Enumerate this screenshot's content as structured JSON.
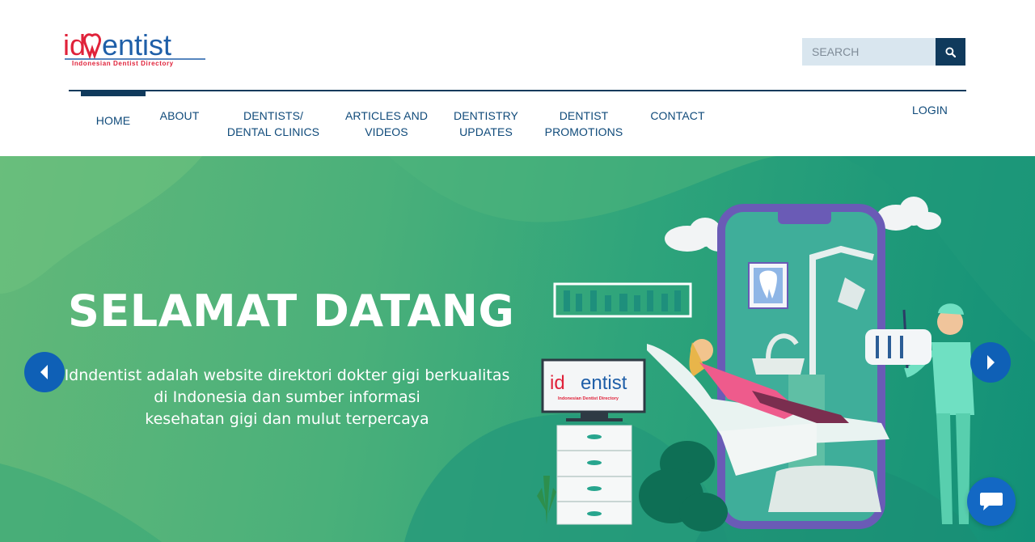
{
  "logo": {
    "wordmark_left": "id",
    "wordmark_right": "entist",
    "tagline": "Indonesian Dentist Directory"
  },
  "search": {
    "placeholder": "SEARCH",
    "icon": "search-icon"
  },
  "nav": {
    "items": [
      {
        "line1": "HOME",
        "line2": "",
        "active": true
      },
      {
        "line1": "ABOUT",
        "line2": ""
      },
      {
        "line1": "DENTISTS/",
        "line2": "DENTAL CLINICS"
      },
      {
        "line1": "ARTICLES AND",
        "line2": "VIDEOS"
      },
      {
        "line1": "DENTISTRY",
        "line2": "UPDATES"
      },
      {
        "line1": "DENTIST",
        "line2": "PROMOTIONS"
      },
      {
        "line1": "CONTACT",
        "line2": ""
      }
    ],
    "login": "LOGIN"
  },
  "hero": {
    "title": "SELAMAT DATANG",
    "subtitle_lines": [
      "Idndentist adalah website direktori dokter gigi berkualitas",
      "di Indonesia dan sumber informasi",
      "kesehatan gigi dan mulut terpercaya"
    ],
    "illustration_monitor_logo_left": "id",
    "illustration_monitor_logo_right": "entist",
    "illustration_monitor_tagline": "Indonesian Dentist Directory"
  },
  "carousel": {
    "prev_icon": "caret-left-icon",
    "next_icon": "caret-right-icon"
  },
  "chat": {
    "icon": "chat-bubble-icon"
  },
  "colors": {
    "brand_navy": "#103a5c",
    "nav_text": "#0f4a7a",
    "logo_red": "#e0223a",
    "logo_blue": "#1f5fa8",
    "hero_green": "#2ea47b",
    "arrow_blue": "#0f60b6",
    "search_bg": "#d9e6ef"
  }
}
